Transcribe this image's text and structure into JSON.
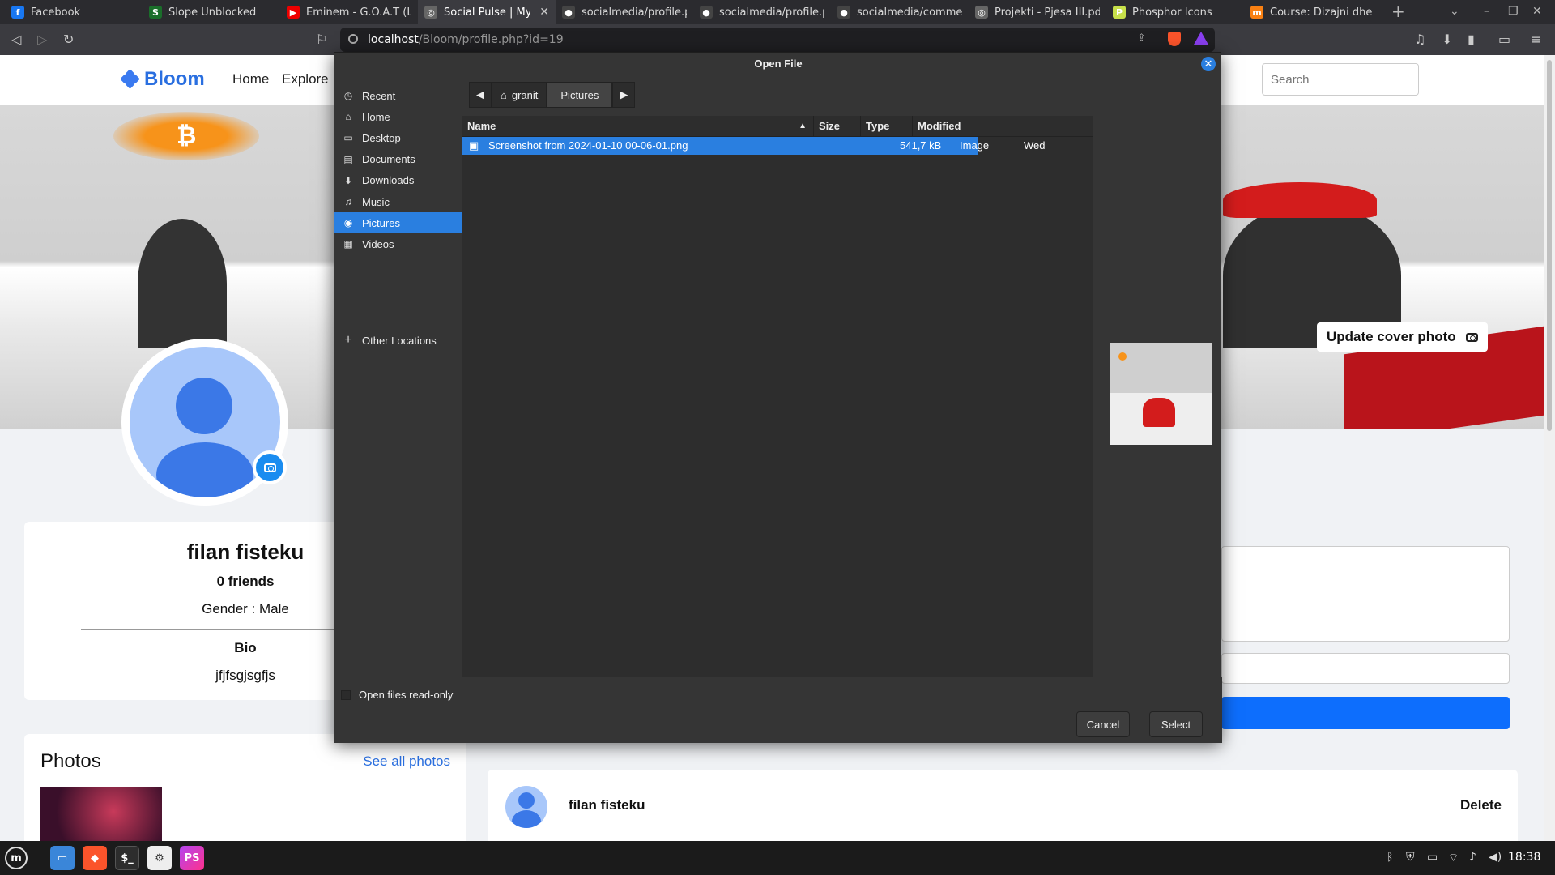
{
  "browser": {
    "tabs": [
      {
        "title": "Facebook",
        "icon": "facebook-icon",
        "color": "#1877f2",
        "glyph": "f"
      },
      {
        "title": "Slope Unblocked",
        "icon": "slope-icon",
        "color": "#1a6e2a",
        "glyph": "S"
      },
      {
        "title": "Eminem - G.O.A.T (L",
        "icon": "youtube-icon",
        "color": "#e00",
        "glyph": "▶"
      },
      {
        "title": "Social Pulse | My P",
        "icon": "globe-icon",
        "color": "#666",
        "glyph": "◎",
        "close": "✕"
      },
      {
        "title": "socialmedia/profile.ph",
        "icon": "github-icon",
        "color": "#444",
        "glyph": "●"
      },
      {
        "title": "socialmedia/profile.ph",
        "icon": "github-icon",
        "color": "#444",
        "glyph": "●"
      },
      {
        "title": "socialmedia/comment",
        "icon": "github-icon",
        "color": "#444",
        "glyph": "●"
      },
      {
        "title": "Projekti - Pjesa III.pdf",
        "icon": "globe-icon",
        "color": "#666",
        "glyph": "◎"
      },
      {
        "title": "Phosphor Icons",
        "icon": "phosphor-icon",
        "color": "#c7e04a",
        "glyph": "P"
      },
      {
        "title": "Course: Dizajni dhe Zhv",
        "icon": "moodle-icon",
        "color": "#f98012",
        "glyph": "m"
      }
    ],
    "new_tab": "+",
    "url_host": "localhost",
    "url_path": "/Bloom/profile.php?id=19"
  },
  "site": {
    "logo": "Bloom",
    "nav": [
      "Home",
      "Explore"
    ],
    "search_placeholder": "Search",
    "update_cover": "Update cover photo",
    "profile": {
      "name": "filan fisteku",
      "friends": "0 friends",
      "gender": "Gender : Male",
      "bio_title": "Bio",
      "bio": "jfjfsgjsgfjs"
    },
    "photos": {
      "title": "Photos",
      "see_all": "See all photos"
    },
    "post": {
      "author": "filan fisteku",
      "delete": "Delete"
    }
  },
  "dialog": {
    "title": "Open File",
    "places": [
      {
        "label": "Recent",
        "icon": "clock-icon",
        "glyph": "◷"
      },
      {
        "label": "Home",
        "icon": "home-icon",
        "glyph": "⌂"
      },
      {
        "label": "Desktop",
        "icon": "desktop-icon",
        "glyph": "▭"
      },
      {
        "label": "Documents",
        "icon": "document-icon",
        "glyph": "▤"
      },
      {
        "label": "Downloads",
        "icon": "download-icon",
        "glyph": "⬇"
      },
      {
        "label": "Music",
        "icon": "music-icon",
        "glyph": "♫"
      },
      {
        "label": "Pictures",
        "icon": "camera-icon",
        "glyph": "◉",
        "selected": true
      },
      {
        "label": "Videos",
        "icon": "film-icon",
        "glyph": "▦"
      }
    ],
    "other_locations": "Other Locations",
    "path": [
      "granit",
      "Pictures"
    ],
    "columns": {
      "name": "Name",
      "size": "Size",
      "type": "Type",
      "modified": "Modified"
    },
    "files": [
      {
        "name": "Screenshot from 2024-01-10 00-06-01.png",
        "size": "541,7 kB",
        "type": "Image",
        "modified": "Wed"
      }
    ],
    "readonly_label": "Open files read-only",
    "cancel": "Cancel",
    "select": "Select"
  },
  "taskbar": {
    "clock": "18:38",
    "apps": [
      "files-icon",
      "brave-icon",
      "terminal-icon",
      "settings-icon",
      "phpstorm-icon"
    ]
  }
}
